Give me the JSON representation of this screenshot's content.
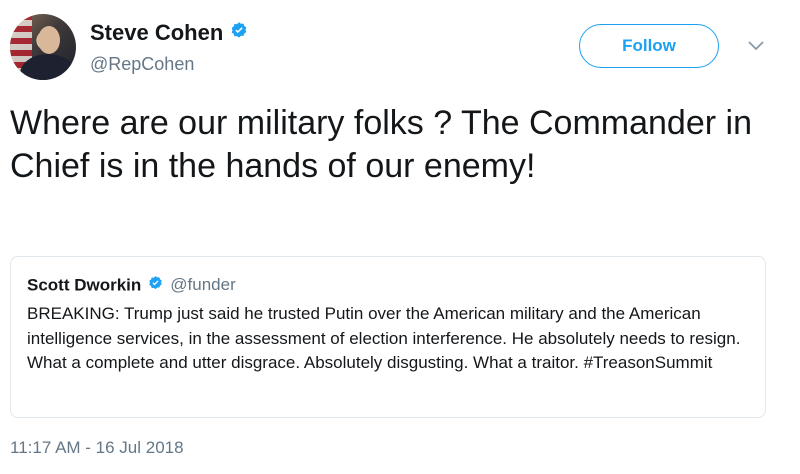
{
  "author": {
    "name": "Steve Cohen",
    "handle": "@RepCohen",
    "verified": true,
    "avatar_icon": "profile-photo"
  },
  "actions": {
    "follow_label": "Follow",
    "more_icon": "chevron-down-icon"
  },
  "tweet": {
    "text": "Where are our military folks ? The Commander in Chief is in the hands of our enemy!",
    "timestamp": "11:17 AM - 16 Jul 2018"
  },
  "quoted_tweet": {
    "name": "Scott Dworkin",
    "handle": "@funder",
    "verified": true,
    "text": "BREAKING: Trump just said he trusted Putin over the American military and the American intelligence services, in the assessment of election interference. He absolutely needs to resign. What a complete and utter disgrace. Absolutely disgusting. What a traitor. #TreasonSummit"
  },
  "colors": {
    "accent": "#1da1f2",
    "text_primary": "#14171a",
    "text_secondary": "#657786",
    "border": "#e1e8ed"
  }
}
